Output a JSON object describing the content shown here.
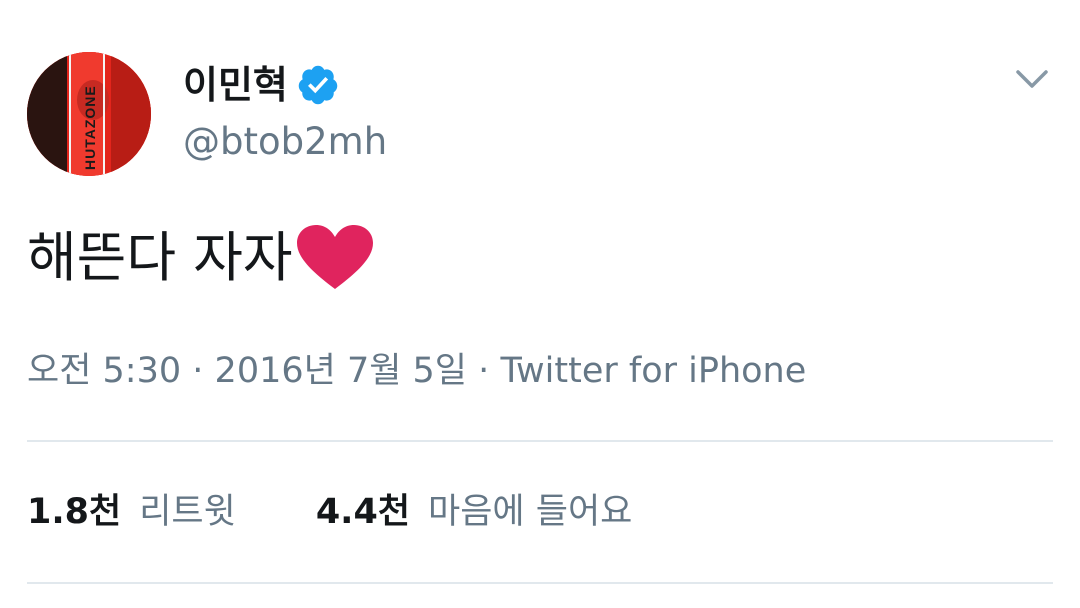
{
  "author": {
    "display_name": "이민혁",
    "username": "@btob2mh",
    "verified": true,
    "avatar_text": "HUTAZONE"
  },
  "tweet": {
    "text": "해뜬다 자자",
    "emoji": "heart"
  },
  "meta": {
    "time": "오전 5:30",
    "separator": "·",
    "date": "2016년 7월 5일",
    "source": "Twitter for iPhone"
  },
  "stats": {
    "retweets_count": "1.8천",
    "retweets_label": "리트윗",
    "likes_count": "4.4천",
    "likes_label": "마음에 들어요"
  },
  "colors": {
    "verified": "#1da1f2",
    "heart": "#e0245e",
    "secondary_text": "#657786",
    "divider": "#e1e8ed"
  }
}
